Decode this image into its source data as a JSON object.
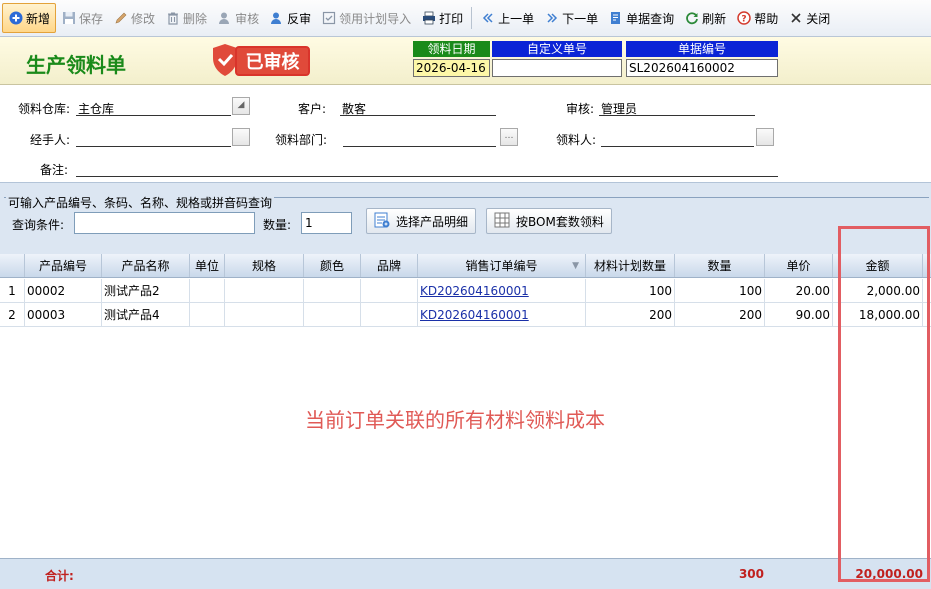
{
  "toolbar": {
    "new": "新增",
    "save": "保存",
    "edit": "修改",
    "delete": "删除",
    "audit": "审核",
    "unaudit": "反审",
    "import_plan": "领用计划导入",
    "print": "打印",
    "prev": "上一单",
    "next": "下一单",
    "query": "单据查询",
    "refresh": "刷新",
    "help": "帮助",
    "close": "关闭"
  },
  "header": {
    "title": "生产领料单",
    "stamp": "已审核",
    "date_label": "领料日期",
    "date_value": "2026-04-16",
    "custom_no_label": "自定义单号",
    "custom_no_value": "",
    "doc_no_label": "单据编号",
    "doc_no_value": "SL202604160002",
    "colors": {
      "title": "#1a8a1a",
      "stamp": "#e04a3a",
      "date_label_bg": "#1a8a1a",
      "no_label_bg": "#0b24d6"
    }
  },
  "form": {
    "warehouse_label": "领料仓库:",
    "warehouse_value": "主仓库",
    "customer_label": "客户:",
    "customer_value": "散客",
    "auditor_label": "审核:",
    "auditor_value": "管理员",
    "handler_label": "经手人:",
    "handler_value": "",
    "dept_label": "领料部门:",
    "dept_value": "",
    "receiver_label": "领料人:",
    "receiver_value": "",
    "note_label": "备注:",
    "note_value": ""
  },
  "query": {
    "legend": "可输入产品编号、条码、名称、规格或拼音码查询",
    "condition_label": "查询条件:",
    "condition_value": "",
    "qty_label": "数量:",
    "qty_value": "1",
    "select_detail_btn": "选择产品明细",
    "bom_btn": "按BOM套数领料"
  },
  "grid": {
    "columns": [
      "产品编号",
      "产品名称",
      "单位",
      "规格",
      "颜色",
      "品牌",
      "销售订单编号",
      "材料计划数量",
      "数量",
      "单价",
      "金额"
    ],
    "rows": [
      {
        "idx": "1",
        "code": "00002",
        "name": "测试产品2",
        "unit": "",
        "spec": "",
        "color": "",
        "brand": "",
        "order": "KD202604160001",
        "plan_qty": "100",
        "qty": "100",
        "price": "20.00",
        "amount": "2,000.00"
      },
      {
        "idx": "2",
        "code": "00003",
        "name": "测试产品4",
        "unit": "",
        "spec": "",
        "color": "",
        "brand": "",
        "order": "KD202604160001",
        "plan_qty": "200",
        "qty": "200",
        "price": "90.00",
        "amount": "18,000.00"
      }
    ]
  },
  "overlay_text": "当前订单关联的所有材料领料成本",
  "footer": {
    "total_label": "合计:",
    "total_qty": "300",
    "total_amount": "20,000.00"
  }
}
